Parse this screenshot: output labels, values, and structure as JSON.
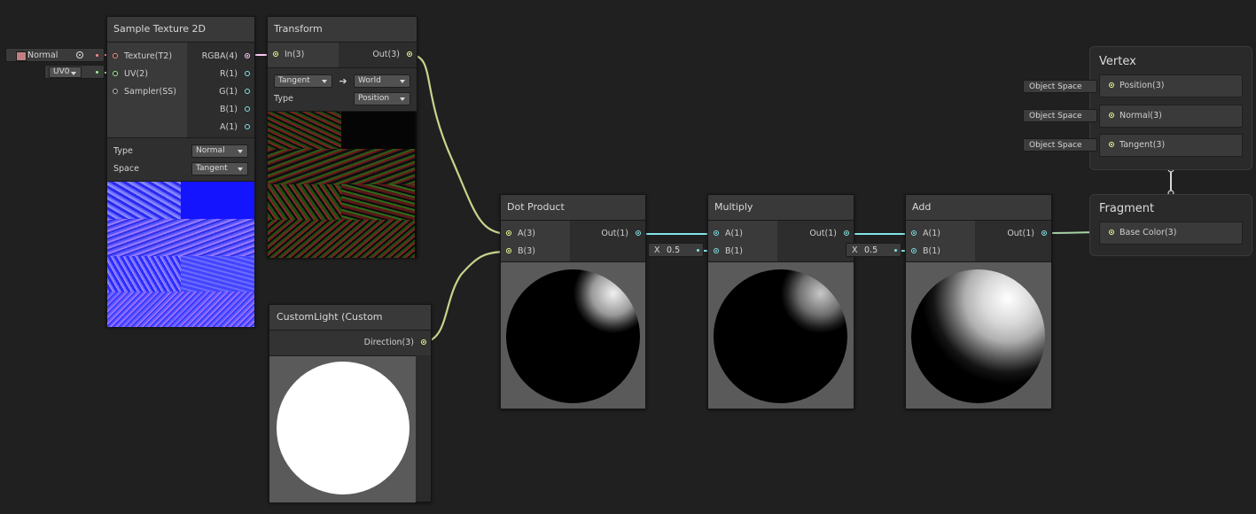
{
  "colors": {
    "background": "#202020",
    "wire_vec1": "#84e4e7",
    "wire_vec3": "#f6ff9a",
    "wire_vec4": "#fbcbf4",
    "wire_texture": "#ff8b8b",
    "wire_uv": "#9aef92",
    "normal_swatch": "#c08080"
  },
  "property_field": {
    "label": "Normal",
    "picker_icon": "target-icon"
  },
  "uv_field": {
    "value": "UV0"
  },
  "sample_texture": {
    "title": "Sample Texture 2D",
    "inputs": [
      "Texture(T2)",
      "UV(2)",
      "Sampler(SS)"
    ],
    "outputs": [
      "RGBA(4)",
      "R(1)",
      "G(1)",
      "B(1)",
      "A(1)"
    ],
    "type_label": "Type",
    "type_value": "Normal",
    "space_label": "Space",
    "space_value": "Tangent"
  },
  "transform": {
    "title": "Transform",
    "input": "In(3)",
    "output": "Out(3)",
    "from_value": "Tangent",
    "arrow": "➔",
    "to_value": "World",
    "type_label": "Type",
    "type_value": "Position"
  },
  "custom_light": {
    "title": "CustomLight (Custom Function)",
    "output": "Direction(3)"
  },
  "dot_product": {
    "title": "Dot Product",
    "inputs": [
      "A(3)",
      "B(3)"
    ],
    "output": "Out(1)"
  },
  "multiply": {
    "title": "Multiply",
    "inputs": [
      "A(1)",
      "B(1)"
    ],
    "output": "Out(1)",
    "b_axis": "X",
    "b_value": "0.5"
  },
  "add": {
    "title": "Add",
    "inputs": [
      "A(1)",
      "B(1)"
    ],
    "output": "Out(1)",
    "b_axis": "X",
    "b_value": "0.5"
  },
  "vertex": {
    "title": "Vertex",
    "blocks": [
      {
        "space": "Object Space",
        "label": "Position(3)"
      },
      {
        "space": "Object Space",
        "label": "Normal(3)"
      },
      {
        "space": "Object Space",
        "label": "Tangent(3)"
      }
    ]
  },
  "fragment": {
    "title": "Fragment",
    "blocks": [
      {
        "label": "Base Color(3)"
      }
    ]
  }
}
